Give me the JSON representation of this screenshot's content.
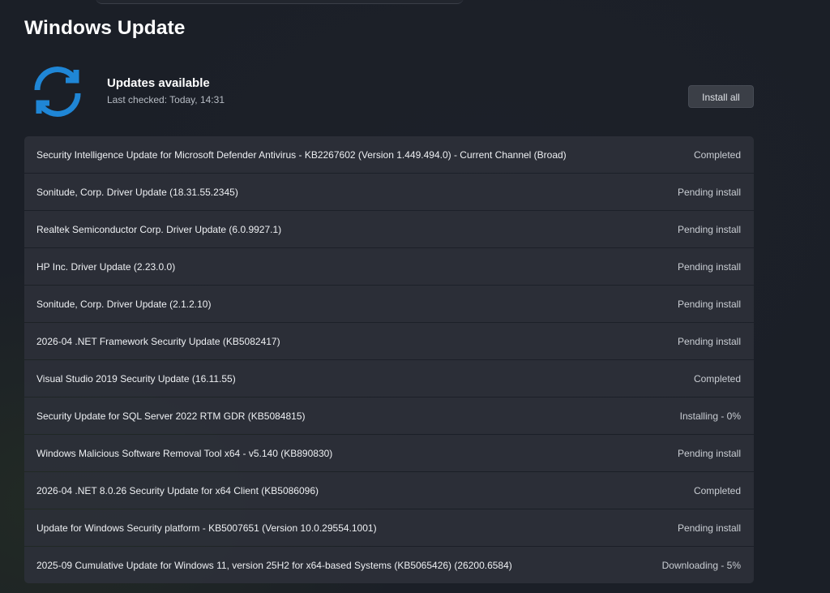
{
  "page": {
    "title": "Windows Update"
  },
  "status": {
    "title": "Updates available",
    "last_checked": "Last checked: Today, 14:31",
    "icon": "sync-icon",
    "accent_color": "#1f86d6"
  },
  "actions": {
    "install_all_label": "Install all"
  },
  "updates": [
    {
      "name": "Security Intelligence Update for Microsoft Defender Antivirus - KB2267602 (Version 1.449.494.0) - Current Channel (Broad)",
      "status": "Completed"
    },
    {
      "name": "Sonitude, Corp. Driver Update (18.31.55.2345)",
      "status": "Pending install"
    },
    {
      "name": "Realtek Semiconductor Corp. Driver Update (6.0.9927.1)",
      "status": "Pending install"
    },
    {
      "name": "HP Inc. Driver Update (2.23.0.0)",
      "status": "Pending install"
    },
    {
      "name": "Sonitude, Corp. Driver Update (2.1.2.10)",
      "status": "Pending install"
    },
    {
      "name": "2026-04 .NET Framework Security Update (KB5082417)",
      "status": "Pending install"
    },
    {
      "name": "Visual Studio 2019 Security Update (16.11.55)",
      "status": "Completed"
    },
    {
      "name": "Security Update for SQL Server 2022 RTM GDR (KB5084815)",
      "status": "Installing - 0%"
    },
    {
      "name": "Windows Malicious Software Removal Tool x64 - v5.140 (KB890830)",
      "status": "Pending install"
    },
    {
      "name": "2026-04 .NET 8.0.26 Security Update for x64 Client (KB5086096)",
      "status": "Completed"
    },
    {
      "name": "Update for Windows Security platform - KB5007651 (Version 10.0.29554.1001)",
      "status": "Pending install"
    },
    {
      "name": "2025-09 Cumulative Update for Windows 11, version 25H2 for x64-based Systems (KB5065426) (26200.6584)",
      "status": "Downloading - 5%"
    }
  ]
}
